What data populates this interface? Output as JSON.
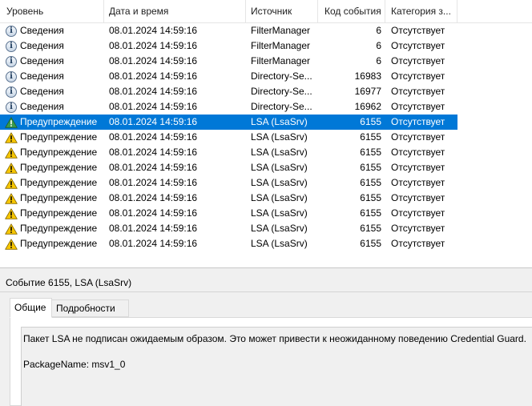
{
  "columns": {
    "level": "Уровень",
    "datetime": "Дата и время",
    "source": "Источник",
    "event_id": "Код события",
    "category": "Категория з..."
  },
  "rows": [
    {
      "icon": "info-icon",
      "level": "Сведения",
      "datetime": "08.01.2024 14:59:16",
      "source": "FilterManager",
      "event_id": "6",
      "category": "Отсутствует"
    },
    {
      "icon": "info-icon",
      "level": "Сведения",
      "datetime": "08.01.2024 14:59:16",
      "source": "FilterManager",
      "event_id": "6",
      "category": "Отсутствует"
    },
    {
      "icon": "info-icon",
      "level": "Сведения",
      "datetime": "08.01.2024 14:59:16",
      "source": "FilterManager",
      "event_id": "6",
      "category": "Отсутствует"
    },
    {
      "icon": "info-icon",
      "level": "Сведения",
      "datetime": "08.01.2024 14:59:16",
      "source": "Directory-Se...",
      "event_id": "16983",
      "category": "Отсутствует"
    },
    {
      "icon": "info-icon",
      "level": "Сведения",
      "datetime": "08.01.2024 14:59:16",
      "source": "Directory-Se...",
      "event_id": "16977",
      "category": "Отсутствует"
    },
    {
      "icon": "info-icon",
      "level": "Сведения",
      "datetime": "08.01.2024 14:59:16",
      "source": "Directory-Se...",
      "event_id": "16962",
      "category": "Отсутствует"
    },
    {
      "icon": "warning-icon",
      "level": "Предупреждение",
      "datetime": "08.01.2024 14:59:16",
      "source": "LSA (LsaSrv)",
      "event_id": "6155",
      "category": "Отсутствует",
      "selected": true
    },
    {
      "icon": "warning-icon",
      "level": "Предупреждение",
      "datetime": "08.01.2024 14:59:16",
      "source": "LSA (LsaSrv)",
      "event_id": "6155",
      "category": "Отсутствует"
    },
    {
      "icon": "warning-icon",
      "level": "Предупреждение",
      "datetime": "08.01.2024 14:59:16",
      "source": "LSA (LsaSrv)",
      "event_id": "6155",
      "category": "Отсутствует"
    },
    {
      "icon": "warning-icon",
      "level": "Предупреждение",
      "datetime": "08.01.2024 14:59:16",
      "source": "LSA (LsaSrv)",
      "event_id": "6155",
      "category": "Отсутствует"
    },
    {
      "icon": "warning-icon",
      "level": "Предупреждение",
      "datetime": "08.01.2024 14:59:16",
      "source": "LSA (LsaSrv)",
      "event_id": "6155",
      "category": "Отсутствует"
    },
    {
      "icon": "warning-icon",
      "level": "Предупреждение",
      "datetime": "08.01.2024 14:59:16",
      "source": "LSA (LsaSrv)",
      "event_id": "6155",
      "category": "Отсутствует"
    },
    {
      "icon": "warning-icon",
      "level": "Предупреждение",
      "datetime": "08.01.2024 14:59:16",
      "source": "LSA (LsaSrv)",
      "event_id": "6155",
      "category": "Отсутствует"
    },
    {
      "icon": "warning-icon",
      "level": "Предупреждение",
      "datetime": "08.01.2024 14:59:16",
      "source": "LSA (LsaSrv)",
      "event_id": "6155",
      "category": "Отсутствует"
    },
    {
      "icon": "warning-icon",
      "level": "Предупреждение",
      "datetime": "08.01.2024 14:59:16",
      "source": "LSA (LsaSrv)",
      "event_id": "6155",
      "category": "Отсутствует"
    }
  ],
  "detail": {
    "title": "Событие 6155, LSA (LsaSrv)",
    "tabs": [
      "Общие",
      "Подробности"
    ],
    "active_tab": "Общие",
    "message": "Пакет LSA не подписан ожидаемым образом. Это может привести к неожиданному поведению Credential Guard.",
    "package": "PackageName: msv1_0"
  },
  "colors": {
    "selection": "#0078d7",
    "panel_bg": "#f0f0f0",
    "warning": "#f7c600"
  }
}
